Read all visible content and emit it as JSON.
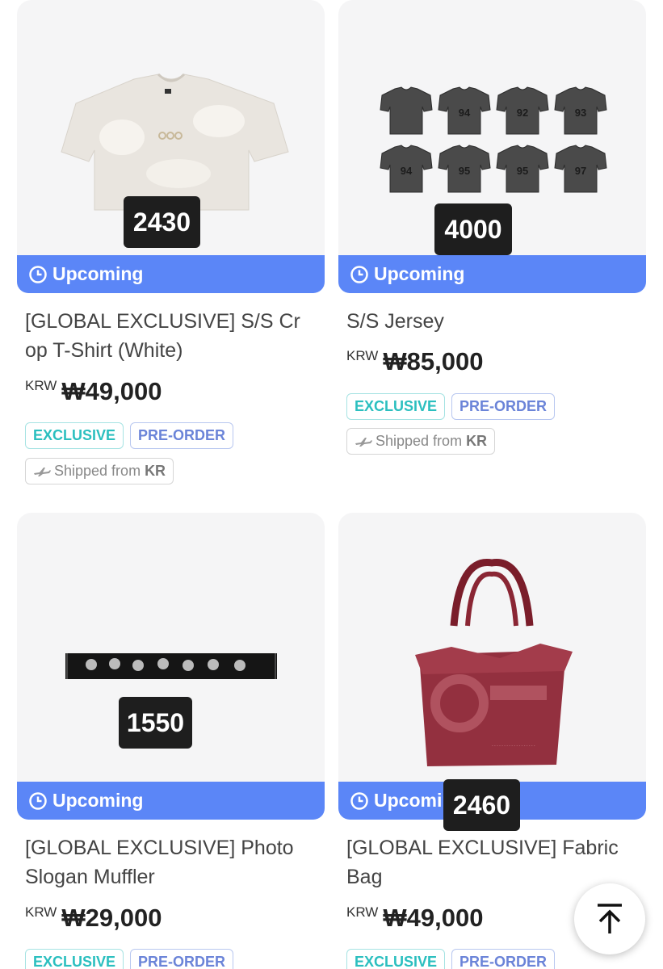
{
  "products": [
    {
      "title_line1": "[GLOBAL EXCLUSIVE] S/S Cr",
      "title_line2": "op T-Shirt (White)",
      "currency": "KRW",
      "price": "₩49,000",
      "count": "2430",
      "status": "Upcoming",
      "tags": [
        "EXCLUSIVE",
        "PRE-ORDER"
      ],
      "shipped_label": "Shipped from",
      "shipped_country": "KR",
      "image": "crop-tshirt-white"
    },
    {
      "title_line1": "S/S Jersey",
      "title_line2": "",
      "currency": "KRW",
      "price": "₩85,000",
      "count": "4000",
      "status": "Upcoming",
      "tags": [
        "EXCLUSIVE",
        "PRE-ORDER"
      ],
      "shipped_label": "Shipped from",
      "shipped_country": "KR",
      "image": "jersey-set",
      "jersey_numbers": [
        "",
        "94",
        "92",
        "93",
        "94",
        "95",
        "95",
        "97"
      ]
    },
    {
      "title_line1": "[GLOBAL EXCLUSIVE] Photo",
      "title_line2": "Slogan Muffler",
      "currency": "KRW",
      "price": "₩29,000",
      "count": "1550",
      "status": "Upcoming",
      "tags": [
        "EXCLUSIVE",
        "PRE-ORDER"
      ],
      "image": "photo-slogan-muffler"
    },
    {
      "title_line1": "[GLOBAL EXCLUSIVE] Fabric",
      "title_line2": "Bag",
      "currency": "KRW",
      "price": "₩49,000",
      "count": "2460",
      "status": "Upcoming",
      "tags": [
        "EXCLUSIVE",
        "PRE-ORDER"
      ],
      "image": "fabric-bag-red"
    }
  ],
  "colors": {
    "banner": "#5b86f7",
    "exclusive": "#2bbfbf",
    "preorder": "#6b84d8"
  },
  "scroll_top_icon": "arrow-up-to-top-icon"
}
